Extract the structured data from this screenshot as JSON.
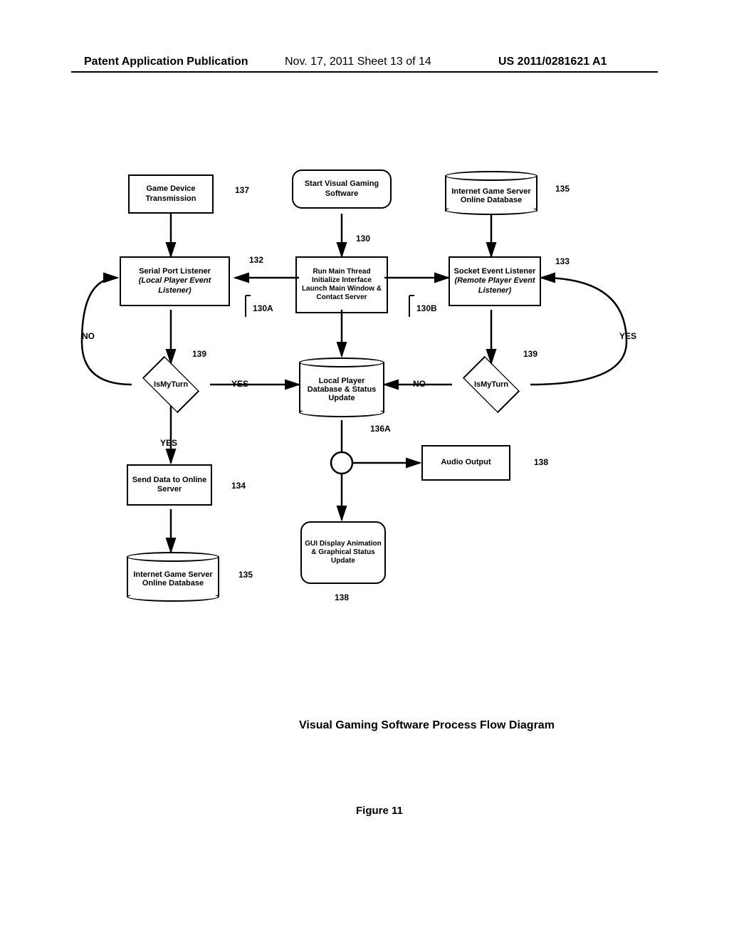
{
  "header": {
    "left": "Patent Application Publication",
    "mid": "Nov. 17, 2011  Sheet 13 of 14",
    "right": "US 2011/0281621 A1"
  },
  "nodes": {
    "gameDevice": "Game Device Transmission",
    "startVisual": "Start Visual Gaming Software",
    "internetDbTop": "Internet Game Server Online Database",
    "serialPort_line1": "Serial Port Listener",
    "serialPort_line2": "(Local Player Event Listener)",
    "runMain": "Run Main Thread Initialize Interface Launch Main Window & Contact Server",
    "socketEvent_line1": "Socket Event Listener",
    "socketEvent_line2": "(Remote Player Event Listener)",
    "isMyTurnL": "IsMyTurn",
    "isMyTurnR": "IsMyTurn",
    "localPlayerDb": "Local Player Database & Status Update",
    "sendData": "Send Data to Online Server",
    "internetDbBot": "Internet Game Server Online Database",
    "audioOutput": "Audio Output",
    "guiDisplay": "GUI Display Animation & Graphical Status Update"
  },
  "labels": {
    "l137": "137",
    "l135a": "135",
    "l130": "130",
    "l132": "132",
    "l133": "133",
    "l130A": "130A",
    "l130B": "130B",
    "l139L": "139",
    "l139R": "139",
    "l136A": "136A",
    "l134": "134",
    "l135b": "135",
    "l138a": "138",
    "l138b": "138",
    "yesL": "YES",
    "yesLdown": "YES",
    "noL": "NO",
    "yesR": "YES",
    "noR": "NO"
  },
  "caption": "Visual Gaming Software Process Flow Diagram",
  "figure": "Figure 11"
}
